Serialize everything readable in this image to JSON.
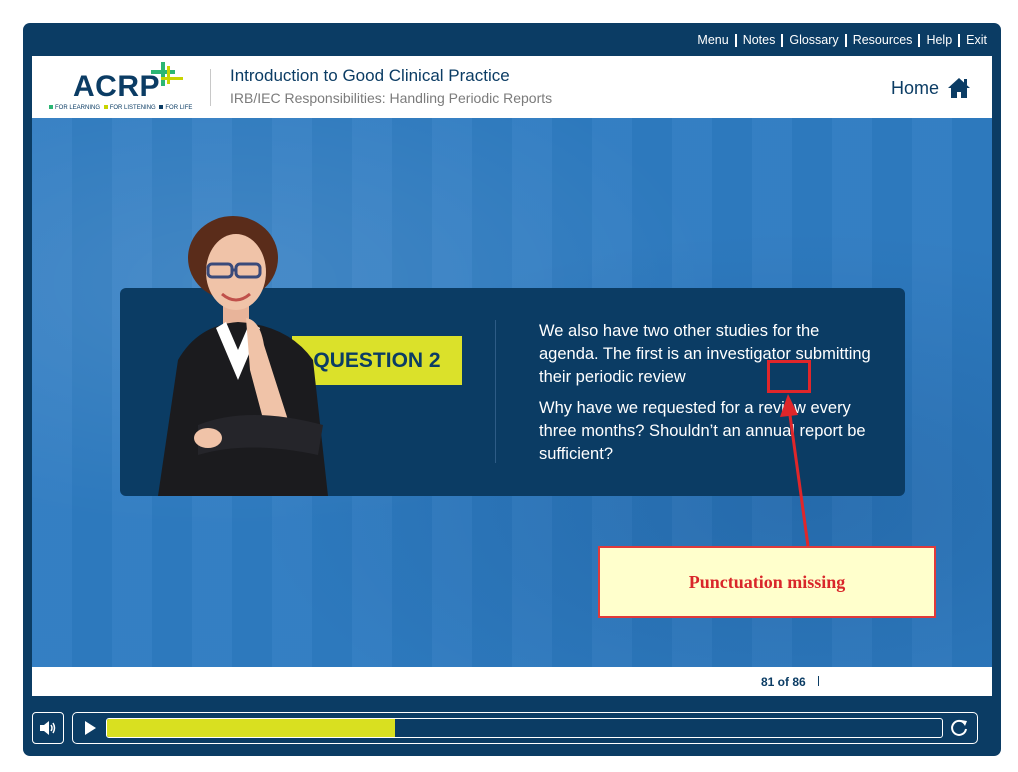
{
  "topnav": {
    "items": [
      "Menu",
      "Notes",
      "Glossary",
      "Resources",
      "Help",
      "Exit"
    ]
  },
  "logo": {
    "wordmark": "ACRP",
    "tagline_1": "FOR LEARNING",
    "tagline_2": "FOR LISTENING",
    "tagline_3": "FOR LIFE"
  },
  "header": {
    "title": "Introduction to Good Clinical Practice",
    "subtitle": "IRB/IEC Responsibilities: Handling Periodic Reports",
    "home_label": "Home"
  },
  "question": {
    "badge": "QUESTION 2",
    "paragraph_1": "We also have two other studies for the agenda. The first is an investigator submitting their periodic review",
    "paragraph_2": "Why have we requested for a review every three months? Shouldn’t an annual report be sufficient?"
  },
  "annotation": {
    "callout_text": "Punctuation missing",
    "color": "#e0262a"
  },
  "footer": {
    "page_counter": "81 of 86"
  },
  "player": {
    "progress": 0.345,
    "progress_color": "#d9e020"
  },
  "colors": {
    "navy": "#0b3c64",
    "stage_blue": "#2e7bc1",
    "accent_yellow": "#dbe12a"
  },
  "icons": {
    "home": "home-icon",
    "volume": "volume-icon",
    "play": "play-icon",
    "replay": "replay-icon"
  }
}
